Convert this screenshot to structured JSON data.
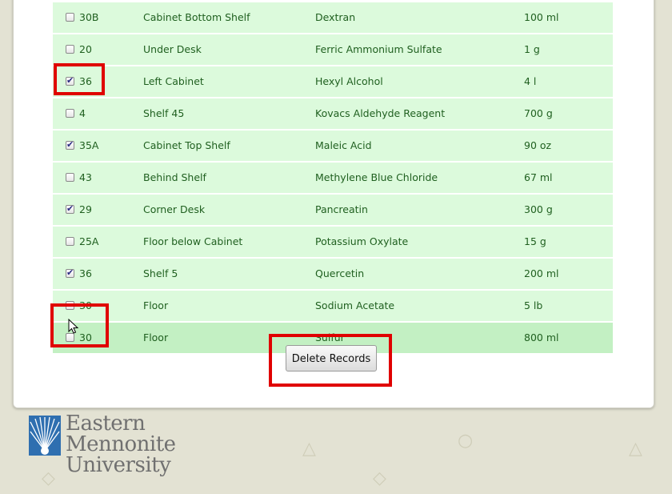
{
  "rows": [
    {
      "room": "30B",
      "location": "Cabinet Bottom Shelf",
      "chemical": "Dextran",
      "quantity": "100 ml",
      "checked": false
    },
    {
      "room": "20",
      "location": "Under Desk",
      "chemical": "Ferric Ammonium Sulfate",
      "quantity": "1 g",
      "checked": false
    },
    {
      "room": "36",
      "location": "Left Cabinet",
      "chemical": "Hexyl Alcohol",
      "quantity": "4 l",
      "checked": true
    },
    {
      "room": "4",
      "location": "Shelf 45",
      "chemical": "Kovacs Aldehyde Reagent",
      "quantity": "700 g",
      "checked": false
    },
    {
      "room": "35A",
      "location": "Cabinet Top Shelf",
      "chemical": "Maleic Acid",
      "quantity": "90 oz",
      "checked": true
    },
    {
      "room": "43",
      "location": "Behind Shelf",
      "chemical": "Methylene Blue Chloride",
      "quantity": "67 ml",
      "checked": false
    },
    {
      "room": "29",
      "location": "Corner Desk",
      "chemical": "Pancreatin",
      "quantity": "300 g",
      "checked": true
    },
    {
      "room": "25A",
      "location": "Floor below Cabinet",
      "chemical": "Potassium Oxylate",
      "quantity": "15 g",
      "checked": false
    },
    {
      "room": "36",
      "location": "Shelf 5",
      "chemical": "Quercetin",
      "quantity": "200 ml",
      "checked": true
    },
    {
      "room": "30",
      "location": "Floor",
      "chemical": "Sodium Acetate",
      "quantity": "5 lb",
      "checked": false
    },
    {
      "room": "30",
      "location": "Floor",
      "chemical": "Sulfur",
      "quantity": "800 ml",
      "checked": false
    }
  ],
  "delete_button": "Delete Records",
  "logo": {
    "line1": "Eastern",
    "line2": "Mennonite",
    "line3": "University"
  },
  "colors": {
    "row_bg": "#dcfadc",
    "row_hover": "#c3f0c3",
    "text": "#206020",
    "highlight": "#e00000"
  }
}
